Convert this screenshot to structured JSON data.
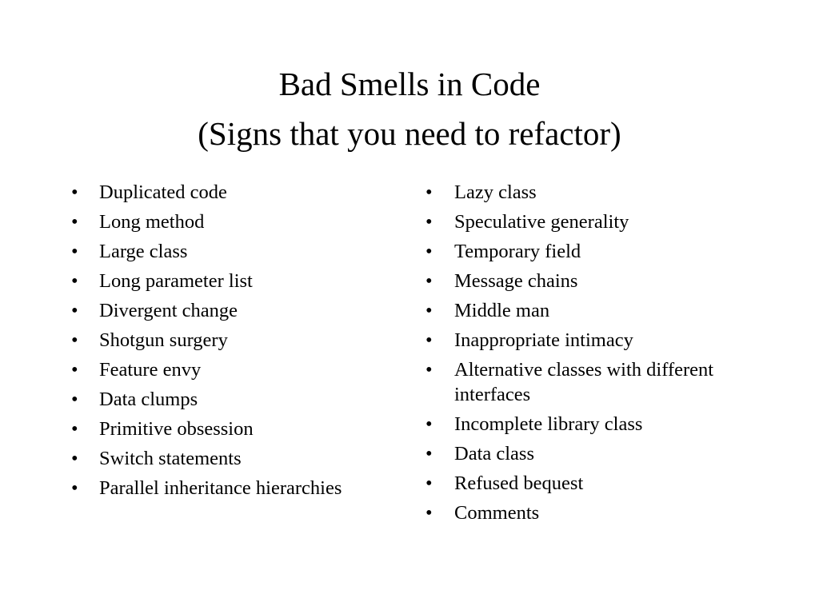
{
  "slide": {
    "background_color": "#ffffff",
    "text_color": "#000000",
    "title": {
      "line1": "Bad Smells in Code",
      "line2": "(Signs that you need to refactor)"
    },
    "bullet_glyph": "•",
    "columns": {
      "left": {
        "items": [
          "Duplicated code",
          "Long method",
          "Large class",
          "Long parameter list",
          "Divergent change",
          "Shotgun surgery",
          "Feature envy",
          "Data clumps",
          "Primitive obsession",
          "Switch statements",
          "Parallel inheritance hierarchies"
        ]
      },
      "right": {
        "items": [
          "Lazy class",
          "Speculative generality",
          "Temporary field",
          "Message chains",
          "Middle man",
          "Inappropriate intimacy",
          "Alternative classes with different interfaces",
          "Incomplete library class",
          "Data class",
          "Refused bequest",
          "Comments"
        ]
      }
    }
  }
}
